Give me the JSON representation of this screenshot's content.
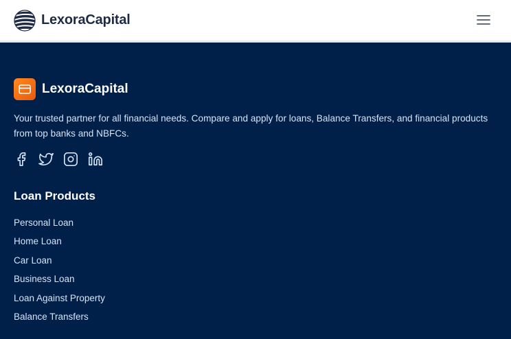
{
  "header": {
    "brand_name": "LexoraCapital",
    "logo_icon": "striped-globe-icon",
    "menu_icon": "hamburger-menu-icon"
  },
  "footer": {
    "brand_name": "LexoraCapital",
    "logo_icon": "credit-card-icon",
    "description": "Your trusted partner for all financial needs. Compare and apply for loans, Balance Transfers, and financial products from top banks and NBFCs.",
    "social_icons": [
      "facebook-icon",
      "twitter-icon",
      "instagram-icon",
      "linkedin-icon"
    ],
    "loan_products": {
      "title": "Loan Products",
      "links": [
        "Personal Loan",
        "Home Loan",
        "Car Loan",
        "Business Loan",
        "Loan Against Property",
        "Balance Transfers"
      ]
    }
  },
  "colors": {
    "footer_bg": "#00204a",
    "header_bg": "#ffffff",
    "brand_text": "#1f2a44",
    "accent_orange": "#f97316",
    "footer_text": "#d5e4f7"
  }
}
